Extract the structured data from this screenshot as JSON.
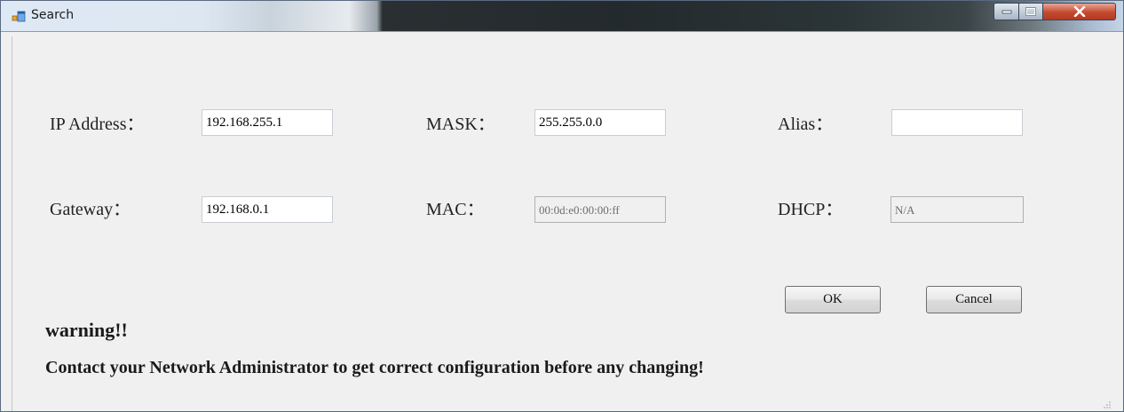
{
  "window": {
    "title": "Search",
    "icon": "app-window-icon"
  },
  "controls": {
    "minimize_icon": "minimize-icon",
    "maximize_icon": "maximize-icon",
    "close_icon": "close-icon"
  },
  "form": {
    "ip_address": {
      "label": "IP Address：",
      "value": "192.168.255.1"
    },
    "mask": {
      "label": "MASK：",
      "value": "255.255.0.0"
    },
    "alias": {
      "label": "Alias：",
      "value": ""
    },
    "gateway": {
      "label": "Gateway：",
      "value": "192.168.0.1"
    },
    "mac": {
      "label": "MAC：",
      "value": "00:0d:e0:00:00:ff"
    },
    "dhcp": {
      "label": "DHCP：",
      "value": "N/A"
    }
  },
  "buttons": {
    "ok": "OK",
    "cancel": "Cancel"
  },
  "warning": {
    "title": "warning!!",
    "message": "Contact your Network Administrator to get correct configuration before any changing!"
  }
}
